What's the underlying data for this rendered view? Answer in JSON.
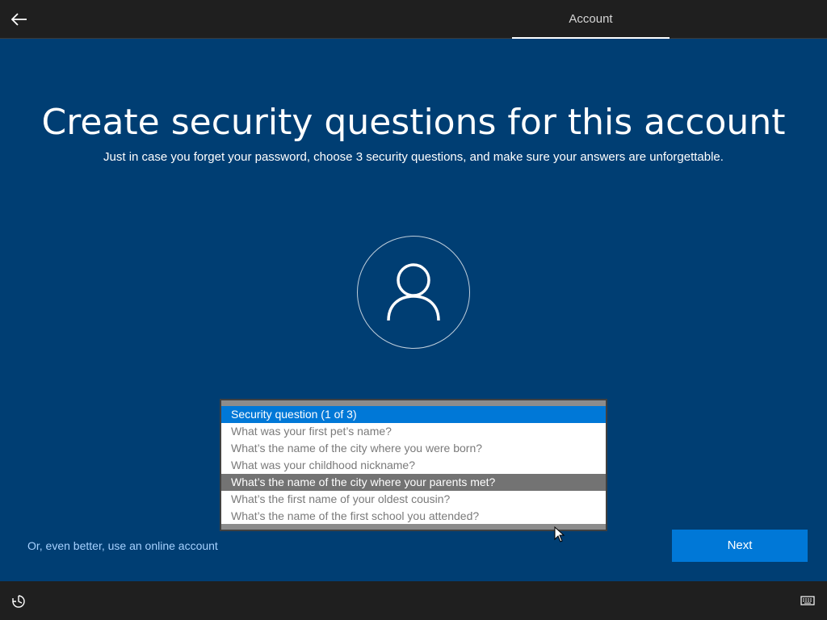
{
  "header": {
    "back_icon": "arrow-left-icon",
    "step_label": "Account"
  },
  "main": {
    "title": "Create security questions for this account",
    "subtitle": "Just in case you forget your password, choose 3 security questions, and make sure your answers are unforgettable.",
    "avatar_icon": "user-icon"
  },
  "dropdown": {
    "selected": "Security question (1 of 3)",
    "options": [
      "What was your first pet’s name?",
      "What’s the name of the city where you were born?",
      "What was your childhood nickname?",
      "What’s the name of the city where your parents met?",
      "What’s the first name of your oldest cousin?",
      "What’s the name of the first school you attended?"
    ],
    "hovered_index": 3
  },
  "footer": {
    "online_account_link": "Or, even better, use an online account",
    "next_label": "Next"
  },
  "bottombar": {
    "ease_of_access_icon": "ease-of-access-icon",
    "keyboard_icon": "keyboard-icon"
  },
  "colors": {
    "background": "#003e73",
    "accent": "#0078d7",
    "bar": "#1f1f1f",
    "link": "#a6d1ff"
  }
}
